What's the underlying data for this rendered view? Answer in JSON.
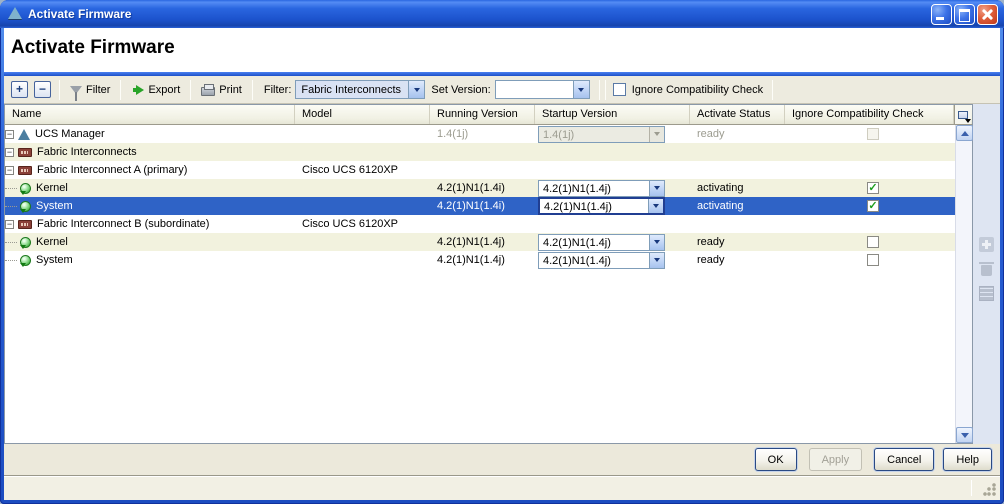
{
  "window": {
    "title": "Activate Firmware",
    "icon": "ucs-triangle-icon",
    "controls": [
      "minimize",
      "maximize",
      "close"
    ]
  },
  "header": {
    "title": "Activate Firmware"
  },
  "toolbar": {
    "expand_glyph": "+",
    "collapse_glyph": "−",
    "filter_button": "Filter",
    "export_button": "Export",
    "print_button": "Print",
    "filter_label": "Filter:",
    "filter_value": "Fabric Interconnects",
    "set_version_label": "Set Version:",
    "set_version_value": "",
    "ignore_compat_label": "Ignore Compatibility Check",
    "ignore_compat_checked": false
  },
  "table": {
    "columns": [
      "Name",
      "Model",
      "Running Version",
      "Startup Version",
      "Activate Status",
      "Ignore Compatibility Check"
    ],
    "expander_glyph": "−",
    "rows": [
      {
        "name": "UCS Manager",
        "icon": "ucs-manager-icon",
        "model": "",
        "running": "1.4(1j)",
        "startup": "1.4(1j)",
        "status": "ready",
        "check": "",
        "checkbox_state": "disabled",
        "selected": false
      },
      {
        "name": "Fabric Interconnects",
        "icon": "fabric-interconnect-icon",
        "model": "",
        "running": "",
        "startup": "",
        "status": "",
        "check": "",
        "checkbox_state": "none",
        "selected": false
      },
      {
        "name": "Fabric Interconnect A (primary)",
        "icon": "fabric-interconnect-icon",
        "model": "Cisco UCS 6120XP",
        "running": "",
        "startup": "",
        "status": "",
        "check": "",
        "checkbox_state": "none",
        "selected": false
      },
      {
        "name": "Kernel",
        "icon": "firmware-image-icon",
        "model": "",
        "running": "4.2(1)N1(1.4i)",
        "startup": "4.2(1)N1(1.4j)",
        "status": "activating",
        "check": "✓",
        "checkbox_state": "checked",
        "selected": false
      },
      {
        "name": "System",
        "icon": "firmware-image-icon",
        "model": "",
        "running": "4.2(1)N1(1.4i)",
        "startup": "4.2(1)N1(1.4j)",
        "status": "activating",
        "check": "✓",
        "checkbox_state": "checked",
        "selected": true
      },
      {
        "name": "Fabric Interconnect B (subordinate)",
        "icon": "fabric-interconnect-icon",
        "model": "Cisco UCS 6120XP",
        "running": "",
        "startup": "",
        "status": "",
        "check": "",
        "checkbox_state": "none",
        "selected": false
      },
      {
        "name": "Kernel",
        "icon": "firmware-image-icon",
        "model": "",
        "running": "4.2(1)N1(1.4j)",
        "startup": "4.2(1)N1(1.4j)",
        "status": "ready",
        "check": "",
        "checkbox_state": "unchecked",
        "selected": false
      },
      {
        "name": "System",
        "icon": "firmware-image-icon",
        "model": "",
        "running": "4.2(1)N1(1.4j)",
        "startup": "4.2(1)N1(1.4j)",
        "status": "ready",
        "check": "",
        "checkbox_state": "unchecked",
        "selected": false
      }
    ]
  },
  "side_panel": {
    "icons": [
      "add-icon",
      "delete-icon",
      "copy-icon"
    ],
    "enabled": false
  },
  "buttons": {
    "ok": "OK",
    "apply": "Apply",
    "cancel": "Cancel",
    "help": "Help"
  },
  "colors": {
    "selection": "#2F63C6",
    "row_stripe": "#F2F2DE",
    "titlebar_blue": "#2A62D8",
    "separator_blue": "#2B65E8",
    "control_bg": "#ECE9DB"
  }
}
